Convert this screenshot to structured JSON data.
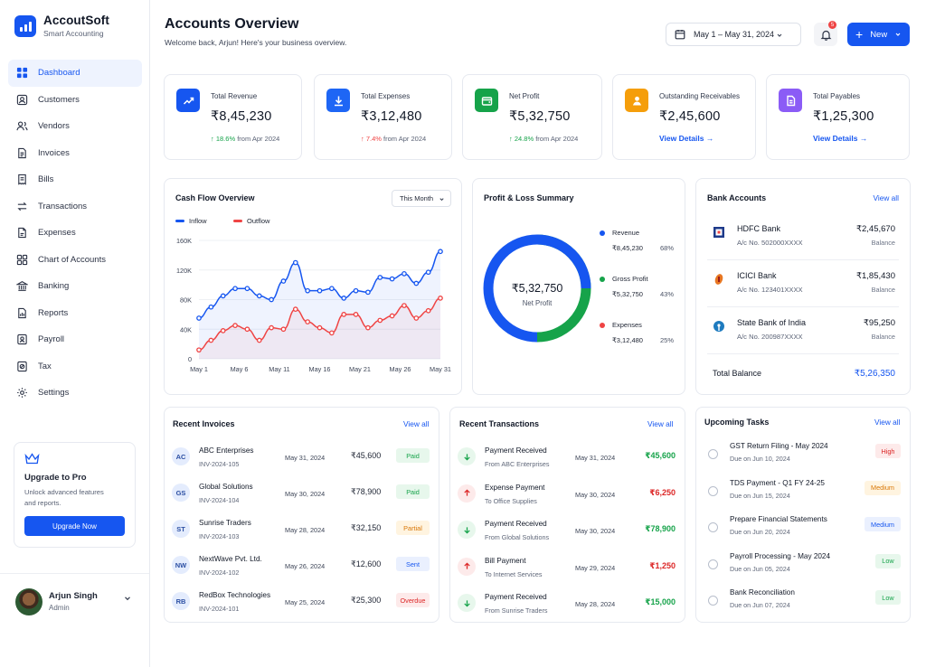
{
  "app": {
    "name": "AccoutSoft",
    "tagline": "Smart Accounting"
  },
  "nav": [
    {
      "label": "Dashboard",
      "icon": "grid-icon",
      "active": true
    },
    {
      "label": "Customers",
      "icon": "users-icon"
    },
    {
      "label": "Vendors",
      "icon": "vendor-icon"
    },
    {
      "label": "Invoices",
      "icon": "invoice-icon"
    },
    {
      "label": "Bills",
      "icon": "bill-icon"
    },
    {
      "label": "Transactions",
      "icon": "transactions-icon"
    },
    {
      "label": "Expenses",
      "icon": "expense-icon"
    },
    {
      "label": "Chart of Accounts",
      "icon": "accounts-icon"
    },
    {
      "label": "Banking",
      "icon": "bank-icon"
    },
    {
      "label": "Reports",
      "icon": "reports-icon"
    },
    {
      "label": "Payroll",
      "icon": "payroll-icon"
    },
    {
      "label": "Tax",
      "icon": "tax-icon"
    },
    {
      "label": "Settings",
      "icon": "gear-icon"
    }
  ],
  "upgrade": {
    "title": "Upgrade to Pro",
    "desc_1": "Unlock advanced features",
    "desc_2": "and reports.",
    "button": "Upgrade Now"
  },
  "profile": {
    "name": "Arjun Singh",
    "role": "Admin"
  },
  "header": {
    "title": "Accounts Overview",
    "subtitle": "Welcome back, Arjun! Here's your business overview.",
    "date_range": "May 1 – May 31, 2024",
    "notification_count": "5",
    "new_button": "New"
  },
  "kpis": {
    "revenue": {
      "label": "Total Revenue",
      "value": "₹8,45,230",
      "change": "18.6%",
      "note": "from Apr 2024",
      "color": "#1656f0"
    },
    "expenses": {
      "label": "Total Expenses",
      "value": "₹3,12,480",
      "change": "7.4%",
      "note": "from Apr 2024",
      "color": "#1e66f5"
    },
    "profit": {
      "label": "Net Profit",
      "value": "₹5,32,750",
      "change": "24.8%",
      "note": "from Apr 2024",
      "color": "#16a34a"
    },
    "receivables": {
      "label": "Outstanding Receivables",
      "value": "₹2,45,600",
      "link": "View Details",
      "color": "#f59e0b"
    },
    "payables": {
      "label": "Total Payables",
      "value": "₹1,25,300",
      "link": "View Details",
      "color": "#8b5cf6"
    }
  },
  "cashflow": {
    "title": "Cash Flow Overview",
    "filter": "This Month",
    "legend_inflow": "Inflow",
    "legend_outflow": "Outflow"
  },
  "chart_data": {
    "type": "line",
    "x": [
      "May 1",
      "May 2",
      "May 3",
      "May 4",
      "May 5",
      "May 6",
      "May 7",
      "May 8",
      "May 9",
      "May 10",
      "May 11",
      "May 12",
      "May 13",
      "May 14",
      "May 15",
      "May 16",
      "May 17",
      "May 18",
      "May 19",
      "May 20",
      "May 21",
      "May 22",
      "May 23",
      "May 24",
      "May 25",
      "May 26",
      "May 27",
      "May 28",
      "May 29",
      "May 30",
      "May 31"
    ],
    "tick_labels": [
      "May 1",
      "May 6",
      "May 11",
      "May 16",
      "May 21",
      "May 26",
      "May 31"
    ],
    "yticks": [
      "160K",
      "120K",
      "80K",
      "40K",
      "0"
    ],
    "ylim": [
      0,
      160000
    ],
    "series": [
      {
        "name": "Inflow",
        "color": "#1656f0",
        "values": [
          55000,
          70000,
          85000,
          95000,
          95000,
          85000,
          80000,
          105000,
          130000,
          92000,
          92000,
          95000,
          82000,
          92000,
          90000,
          110000,
          108000,
          115000,
          102000,
          117000,
          145000
        ]
      },
      {
        "name": "Outflow",
        "color": "#ef4444",
        "values": [
          12000,
          25000,
          38000,
          45000,
          40000,
          25000,
          42000,
          40000,
          67000,
          50000,
          42000,
          35000,
          60000,
          60000,
          42000,
          52000,
          58000,
          72000,
          55000,
          65000,
          82000
        ]
      }
    ]
  },
  "pl": {
    "title": "Profit & Loss Summary",
    "center_value": "₹5,32,750",
    "center_label": "Net Profit",
    "items": [
      {
        "label": "Revenue",
        "value": "₹8,45,230",
        "pct": "68%",
        "color": "#1656f0",
        "share": 0.68
      },
      {
        "label": "Gross Profit",
        "value": "₹5,32,750",
        "pct": "43%",
        "color": "#16a34a",
        "share": 0.43
      },
      {
        "label": "Expenses",
        "value": "₹3,12,480",
        "pct": "25%",
        "color": "#ef4444",
        "share": 0.25
      }
    ]
  },
  "banks": {
    "title": "Bank Accounts",
    "view_all": "View all",
    "items": [
      {
        "name": "HDFC Bank",
        "account": "A/c No. 502000XXXX",
        "amount": "₹2,45,670",
        "balance_label": "Balance"
      },
      {
        "name": "ICICI Bank",
        "account": "A/c No. 123401XXXX",
        "amount": "₹1,85,430",
        "balance_label": "Balance"
      },
      {
        "name": "State Bank of India",
        "account": "A/c No. 200987XXXX",
        "amount": "₹95,250",
        "balance_label": "Balance"
      }
    ],
    "total_label": "Total Balance",
    "total_value": "₹5,26,350"
  },
  "invoices": {
    "title": "Recent Invoices",
    "view_all": "View all",
    "items": [
      {
        "initials": "AC",
        "name": "ABC Enterprises",
        "number": "INV-2024-105",
        "date": "May 31, 2024",
        "amount": "₹45,600",
        "status": "Paid"
      },
      {
        "initials": "GS",
        "name": "Global Solutions",
        "number": "INV-2024-104",
        "date": "May 30, 2024",
        "amount": "₹78,900",
        "status": "Paid"
      },
      {
        "initials": "ST",
        "name": "Sunrise Traders",
        "number": "INV-2024-103",
        "date": "May 28, 2024",
        "amount": "₹32,150",
        "status": "Partial"
      },
      {
        "initials": "NW",
        "name": "NextWave Pvt. Ltd.",
        "number": "INV-2024-102",
        "date": "May 26, 2024",
        "amount": "₹12,600",
        "status": "Sent"
      },
      {
        "initials": "RB",
        "name": "RedBox Technologies",
        "number": "INV-2024-101",
        "date": "May 25, 2024",
        "amount": "₹25,300",
        "status": "Overdue"
      }
    ]
  },
  "transactions": {
    "title": "Recent Transactions",
    "view_all": "View all",
    "items": [
      {
        "direction": "in",
        "title": "Payment Received",
        "sub": "From ABC Enterprises",
        "date": "May 31, 2024",
        "amount": "₹45,600"
      },
      {
        "direction": "out",
        "title": "Expense Payment",
        "sub": "To Office Supplies",
        "date": "May 30, 2024",
        "amount": "₹6,250"
      },
      {
        "direction": "in",
        "title": "Payment Received",
        "sub": "From Global Solutions",
        "date": "May 30, 2024",
        "amount": "₹78,900"
      },
      {
        "direction": "out",
        "title": "Bill Payment",
        "sub": "To Internet Services",
        "date": "May 29, 2024",
        "amount": "₹1,250"
      },
      {
        "direction": "in",
        "title": "Payment Received",
        "sub": "From Sunrise Traders",
        "date": "May 28, 2024",
        "amount": "₹15,000"
      }
    ]
  },
  "tasks": {
    "title": "Upcoming Tasks",
    "view_all": "View all",
    "items": [
      {
        "title": "GST Return Filing - May 2024",
        "due": "Due on Jun 10, 2024",
        "priority": "High"
      },
      {
        "title": "TDS Payment - Q1 FY 24-25",
        "due": "Due on Jun 15, 2024",
        "priority": "Medium"
      },
      {
        "title": "Prepare Financial Statements",
        "due": "Due on Jun 20, 2024",
        "priority": "Medium"
      },
      {
        "title": "Payroll Processing - May 2024",
        "due": "Due on Jun 05, 2024",
        "priority": "Low"
      },
      {
        "title": "Bank Reconciliation",
        "due": "Due on Jun 07, 2024",
        "priority": "Low"
      }
    ]
  }
}
